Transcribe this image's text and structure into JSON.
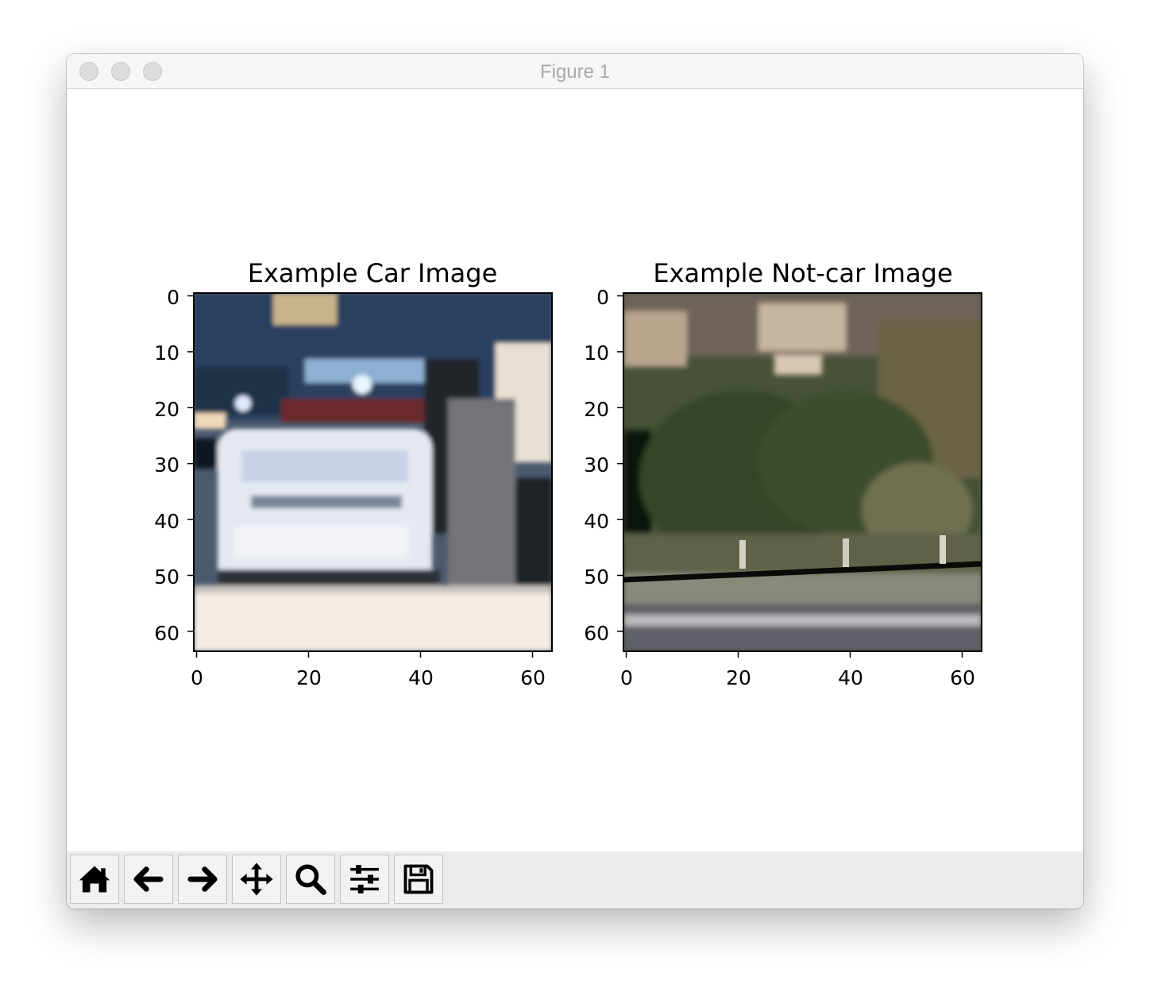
{
  "window": {
    "title": "Figure 1"
  },
  "figure": {
    "panels": [
      {
        "title": "Example Car Image",
        "image_subject": "rear view of a small white car on a road",
        "xticks": [
          "0",
          "20",
          "40",
          "60"
        ],
        "yticks": [
          "0",
          "10",
          "20",
          "30",
          "40",
          "50",
          "60"
        ]
      },
      {
        "title": "Example Not-car Image",
        "image_subject": "roadside vegetation above a guardrail",
        "xticks": [
          "0",
          "20",
          "40",
          "60"
        ],
        "yticks": [
          "0",
          "10",
          "20",
          "30",
          "40",
          "50",
          "60"
        ]
      }
    ]
  },
  "chart_data": [
    {
      "type": "image",
      "title": "Example Car Image",
      "xlim": [
        0,
        63
      ],
      "ylim": [
        63,
        0
      ],
      "xticks": [
        0,
        20,
        40,
        60
      ],
      "yticks": [
        0,
        10,
        20,
        30,
        40,
        50,
        60
      ]
    },
    {
      "type": "image",
      "title": "Example Not-car Image",
      "xlim": [
        0,
        63
      ],
      "ylim": [
        63,
        0
      ],
      "xticks": [
        0,
        20,
        40,
        60
      ],
      "yticks": [
        0,
        10,
        20,
        30,
        40,
        50,
        60
      ]
    }
  ],
  "toolbar": {
    "buttons": [
      {
        "icon": "home-icon",
        "action": "home"
      },
      {
        "icon": "back-arrow-icon",
        "action": "back"
      },
      {
        "icon": "forward-arrow-icon",
        "action": "forward"
      },
      {
        "icon": "pan-move-icon",
        "action": "pan"
      },
      {
        "icon": "zoom-magnifier-icon",
        "action": "zoom"
      },
      {
        "icon": "sliders-icon",
        "action": "configure-subplots"
      },
      {
        "icon": "save-floppy-icon",
        "action": "save"
      }
    ]
  },
  "colors": {
    "titlebar": "#f6f6f6",
    "toolbar": "#ececec",
    "button_face": "#f2f2f2"
  }
}
